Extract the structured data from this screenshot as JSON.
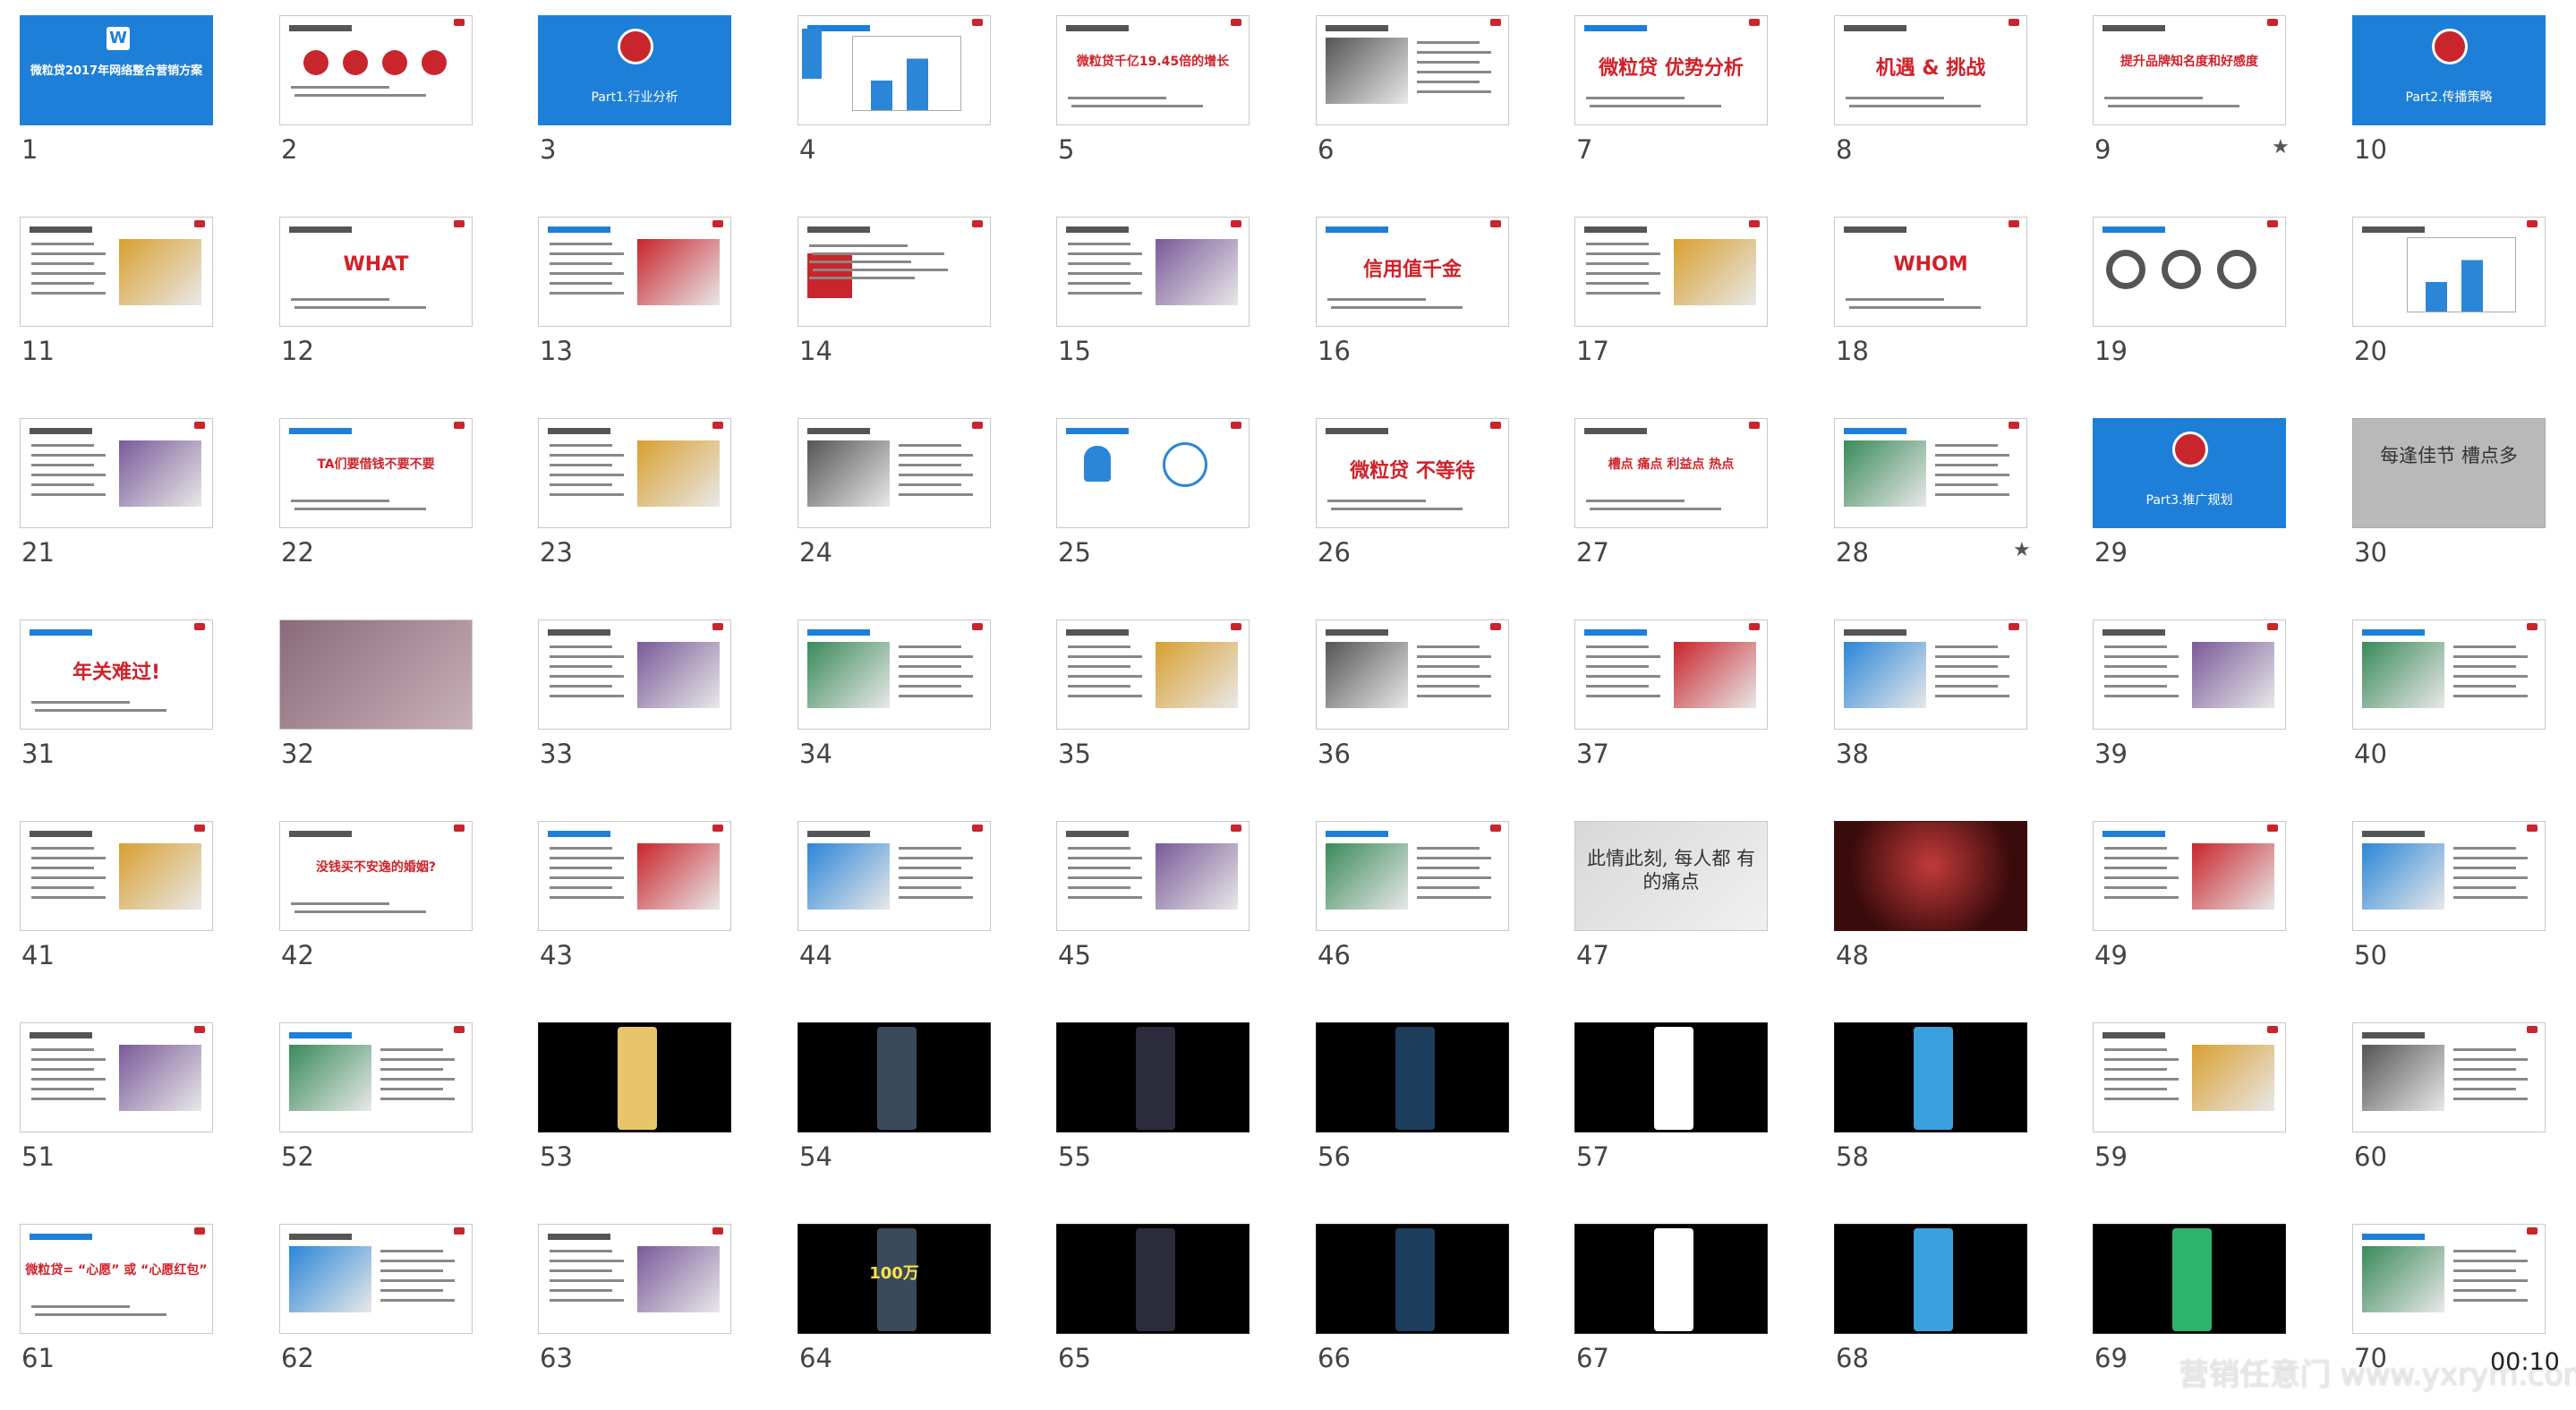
{
  "slides": [
    {
      "num": "1",
      "style": "blue",
      "text": "微粒贷2017年网络整合营销方案",
      "logo": "w-logo"
    },
    {
      "num": "2",
      "style": "white",
      "text": "",
      "icons": "four-red-circles"
    },
    {
      "num": "3",
      "style": "blue",
      "text": "Part1.行业分析",
      "logo": "red-circle-logo"
    },
    {
      "num": "4",
      "style": "white",
      "text": "",
      "icons": "line-chart"
    },
    {
      "num": "5",
      "style": "white",
      "text": "微粒贷千亿19.45倍的增长"
    },
    {
      "num": "6",
      "style": "white",
      "text": ""
    },
    {
      "num": "7",
      "style": "white",
      "text": "微粒贷 优势分析"
    },
    {
      "num": "8",
      "style": "white",
      "text": "机遇 & 挑战"
    },
    {
      "num": "9",
      "style": "white",
      "text": "提升品牌知名度和好感度",
      "starred": true
    },
    {
      "num": "10",
      "style": "blue",
      "text": "Part2.传播策略",
      "logo": "red-circle-logo"
    },
    {
      "num": "11",
      "style": "white",
      "text": ""
    },
    {
      "num": "12",
      "style": "white",
      "text": "WHAT"
    },
    {
      "num": "13",
      "style": "white",
      "text": ""
    },
    {
      "num": "14",
      "style": "white",
      "text": "",
      "icons": "kfc"
    },
    {
      "num": "15",
      "style": "white",
      "text": ""
    },
    {
      "num": "16",
      "style": "white",
      "text": "信用值千金"
    },
    {
      "num": "17",
      "style": "white",
      "text": ""
    },
    {
      "num": "18",
      "style": "white",
      "text": "WHOM"
    },
    {
      "num": "19",
      "style": "white",
      "text": "",
      "icons": "donuts"
    },
    {
      "num": "20",
      "style": "white",
      "text": "",
      "icons": "bar-chart"
    },
    {
      "num": "21",
      "style": "white",
      "text": ""
    },
    {
      "num": "22",
      "style": "white",
      "text": "TA们要借钱不要不要"
    },
    {
      "num": "23",
      "style": "white",
      "text": ""
    },
    {
      "num": "24",
      "style": "white",
      "text": ""
    },
    {
      "num": "25",
      "style": "white",
      "text": "",
      "icons": "w-circle"
    },
    {
      "num": "26",
      "style": "white",
      "text": "微粒贷 不等待"
    },
    {
      "num": "27",
      "style": "white",
      "text": "槽点 痛点 利益点 热点"
    },
    {
      "num": "28",
      "style": "white",
      "text": "",
      "starred": true
    },
    {
      "num": "29",
      "style": "blue",
      "text": "Part3.推广规划",
      "logo": "chat-logo"
    },
    {
      "num": "30",
      "style": "gray",
      "text": "每逢佳节 槽点多"
    },
    {
      "num": "31",
      "style": "white",
      "text": "年关难过!"
    },
    {
      "num": "32",
      "style": "photo",
      "text": ""
    },
    {
      "num": "33",
      "style": "white",
      "text": ""
    },
    {
      "num": "34",
      "style": "white",
      "text": ""
    },
    {
      "num": "35",
      "style": "white",
      "text": ""
    },
    {
      "num": "36",
      "style": "white",
      "text": ""
    },
    {
      "num": "37",
      "style": "white",
      "text": ""
    },
    {
      "num": "38",
      "style": "white",
      "text": ""
    },
    {
      "num": "39",
      "style": "white",
      "text": ""
    },
    {
      "num": "40",
      "style": "white",
      "text": ""
    },
    {
      "num": "41",
      "style": "white",
      "text": ""
    },
    {
      "num": "42",
      "style": "white",
      "text": "没钱买不安逸的婚姻?"
    },
    {
      "num": "43",
      "style": "white",
      "text": ""
    },
    {
      "num": "44",
      "style": "white",
      "text": ""
    },
    {
      "num": "45",
      "style": "white",
      "text": ""
    },
    {
      "num": "46",
      "style": "white",
      "text": ""
    },
    {
      "num": "47",
      "style": "photo",
      "text": "此情此刻, 每人都 有的痛点"
    },
    {
      "num": "48",
      "style": "dark",
      "text": ""
    },
    {
      "num": "49",
      "style": "white",
      "text": ""
    },
    {
      "num": "50",
      "style": "white",
      "text": ""
    },
    {
      "num": "51",
      "style": "white",
      "text": ""
    },
    {
      "num": "52",
      "style": "white",
      "text": ""
    },
    {
      "num": "53",
      "style": "black",
      "text": ""
    },
    {
      "num": "54",
      "style": "black",
      "text": ""
    },
    {
      "num": "55",
      "style": "black",
      "text": ""
    },
    {
      "num": "56",
      "style": "black",
      "text": ""
    },
    {
      "num": "57",
      "style": "black",
      "text": ""
    },
    {
      "num": "58",
      "style": "black",
      "text": ""
    },
    {
      "num": "59",
      "style": "white",
      "text": ""
    },
    {
      "num": "60",
      "style": "white",
      "text": ""
    },
    {
      "num": "61",
      "style": "white",
      "text": "微粒贷= “心愿” 或 “心愿红包”"
    },
    {
      "num": "62",
      "style": "white",
      "text": ""
    },
    {
      "num": "63",
      "style": "white",
      "text": ""
    },
    {
      "num": "64",
      "style": "black",
      "text": "100万"
    },
    {
      "num": "65",
      "style": "black",
      "text": ""
    },
    {
      "num": "66",
      "style": "black",
      "text": ""
    },
    {
      "num": "67",
      "style": "black",
      "text": ""
    },
    {
      "num": "68",
      "style": "black",
      "text": ""
    },
    {
      "num": "69",
      "style": "black",
      "text": ""
    },
    {
      "num": "70",
      "style": "white",
      "text": ""
    }
  ],
  "watermark": "营销任意门 www.yxrym.com",
  "timer": "00:10"
}
